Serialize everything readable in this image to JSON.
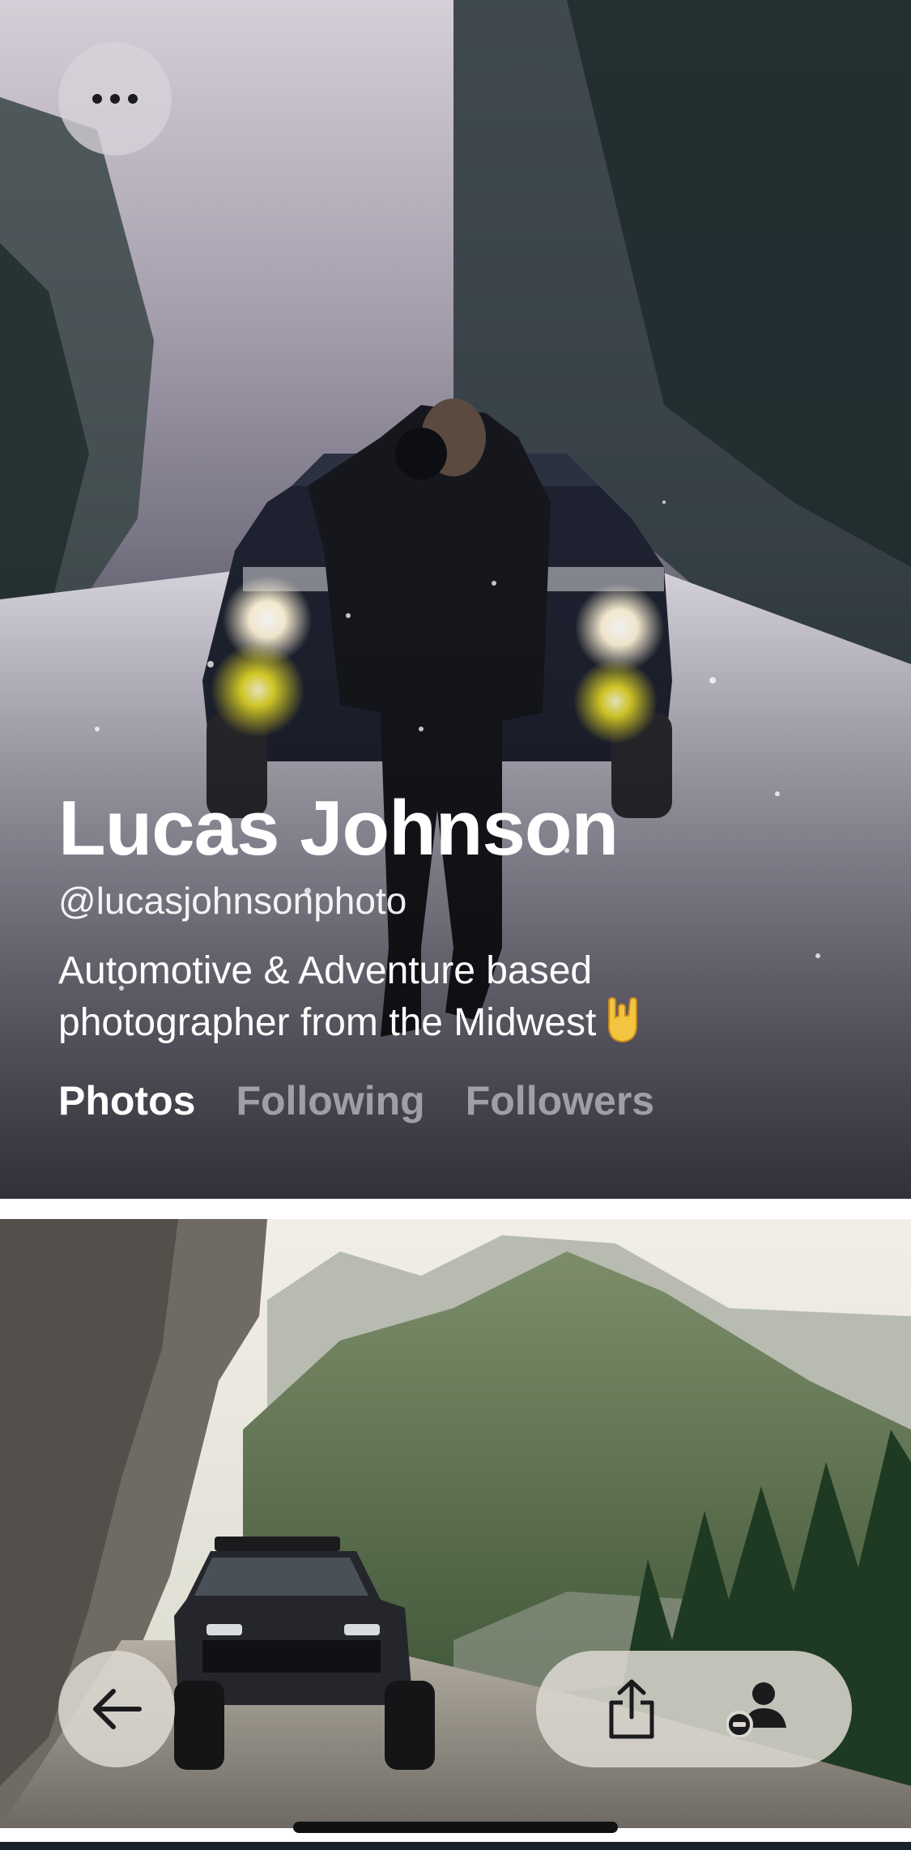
{
  "profile": {
    "name": "Lucas Johnson",
    "handle": "@lucasjohnsonphoto",
    "bio_line1": "Automotive & Adventure based",
    "bio_line2": "photographer from the Midwest"
  },
  "tabs": [
    {
      "label": "Photos",
      "active": true
    },
    {
      "label": "Following",
      "active": false
    },
    {
      "label": "Followers",
      "active": false
    }
  ],
  "icons": {
    "top_left": "more-horizontal-icon",
    "bio_emoji": "rock-on-hand-emoji",
    "back": "arrow-left-icon",
    "share": "share-icon",
    "unfollow": "remove-person-icon"
  },
  "colors": {
    "text_primary": "#ffffff",
    "tab_inactive": "#a9a9ae",
    "button_bg": "#dcd8d2",
    "icon": "#1b1b1d"
  }
}
